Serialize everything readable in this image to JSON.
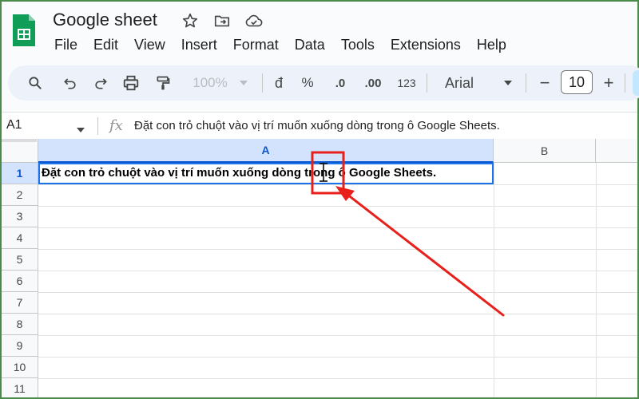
{
  "app": {
    "title": "Google sheet"
  },
  "menu": [
    "File",
    "Edit",
    "View",
    "Insert",
    "Format",
    "Data",
    "Tools",
    "Extensions",
    "Help"
  ],
  "toolbar": {
    "zoom": "100%",
    "currency": "đ",
    "percent": "%",
    "decrease_decimal": ".0",
    "increase_decimal": ".00",
    "number_format": "123",
    "font": "Arial",
    "font_size": "10",
    "minus": "−",
    "plus": "+"
  },
  "formula_bar": {
    "name_box": "A1",
    "fx": "fx",
    "content": "Đặt con trỏ chuột vào vị trí muốn xuống dòng trong ô Google Sheets."
  },
  "grid": {
    "columns": [
      "A",
      "B"
    ],
    "rows": [
      "1",
      "2",
      "3",
      "4",
      "5",
      "6",
      "7",
      "8",
      "9",
      "10",
      "11"
    ],
    "cell_a1": "Đặt con trỏ chuột vào vị trí muốn xuống dòng trong ô Google Sheets."
  },
  "colors": {
    "brand_green": "#0f9d58",
    "selection_blue": "#1a73e8",
    "annotation_red": "#e8201c"
  }
}
